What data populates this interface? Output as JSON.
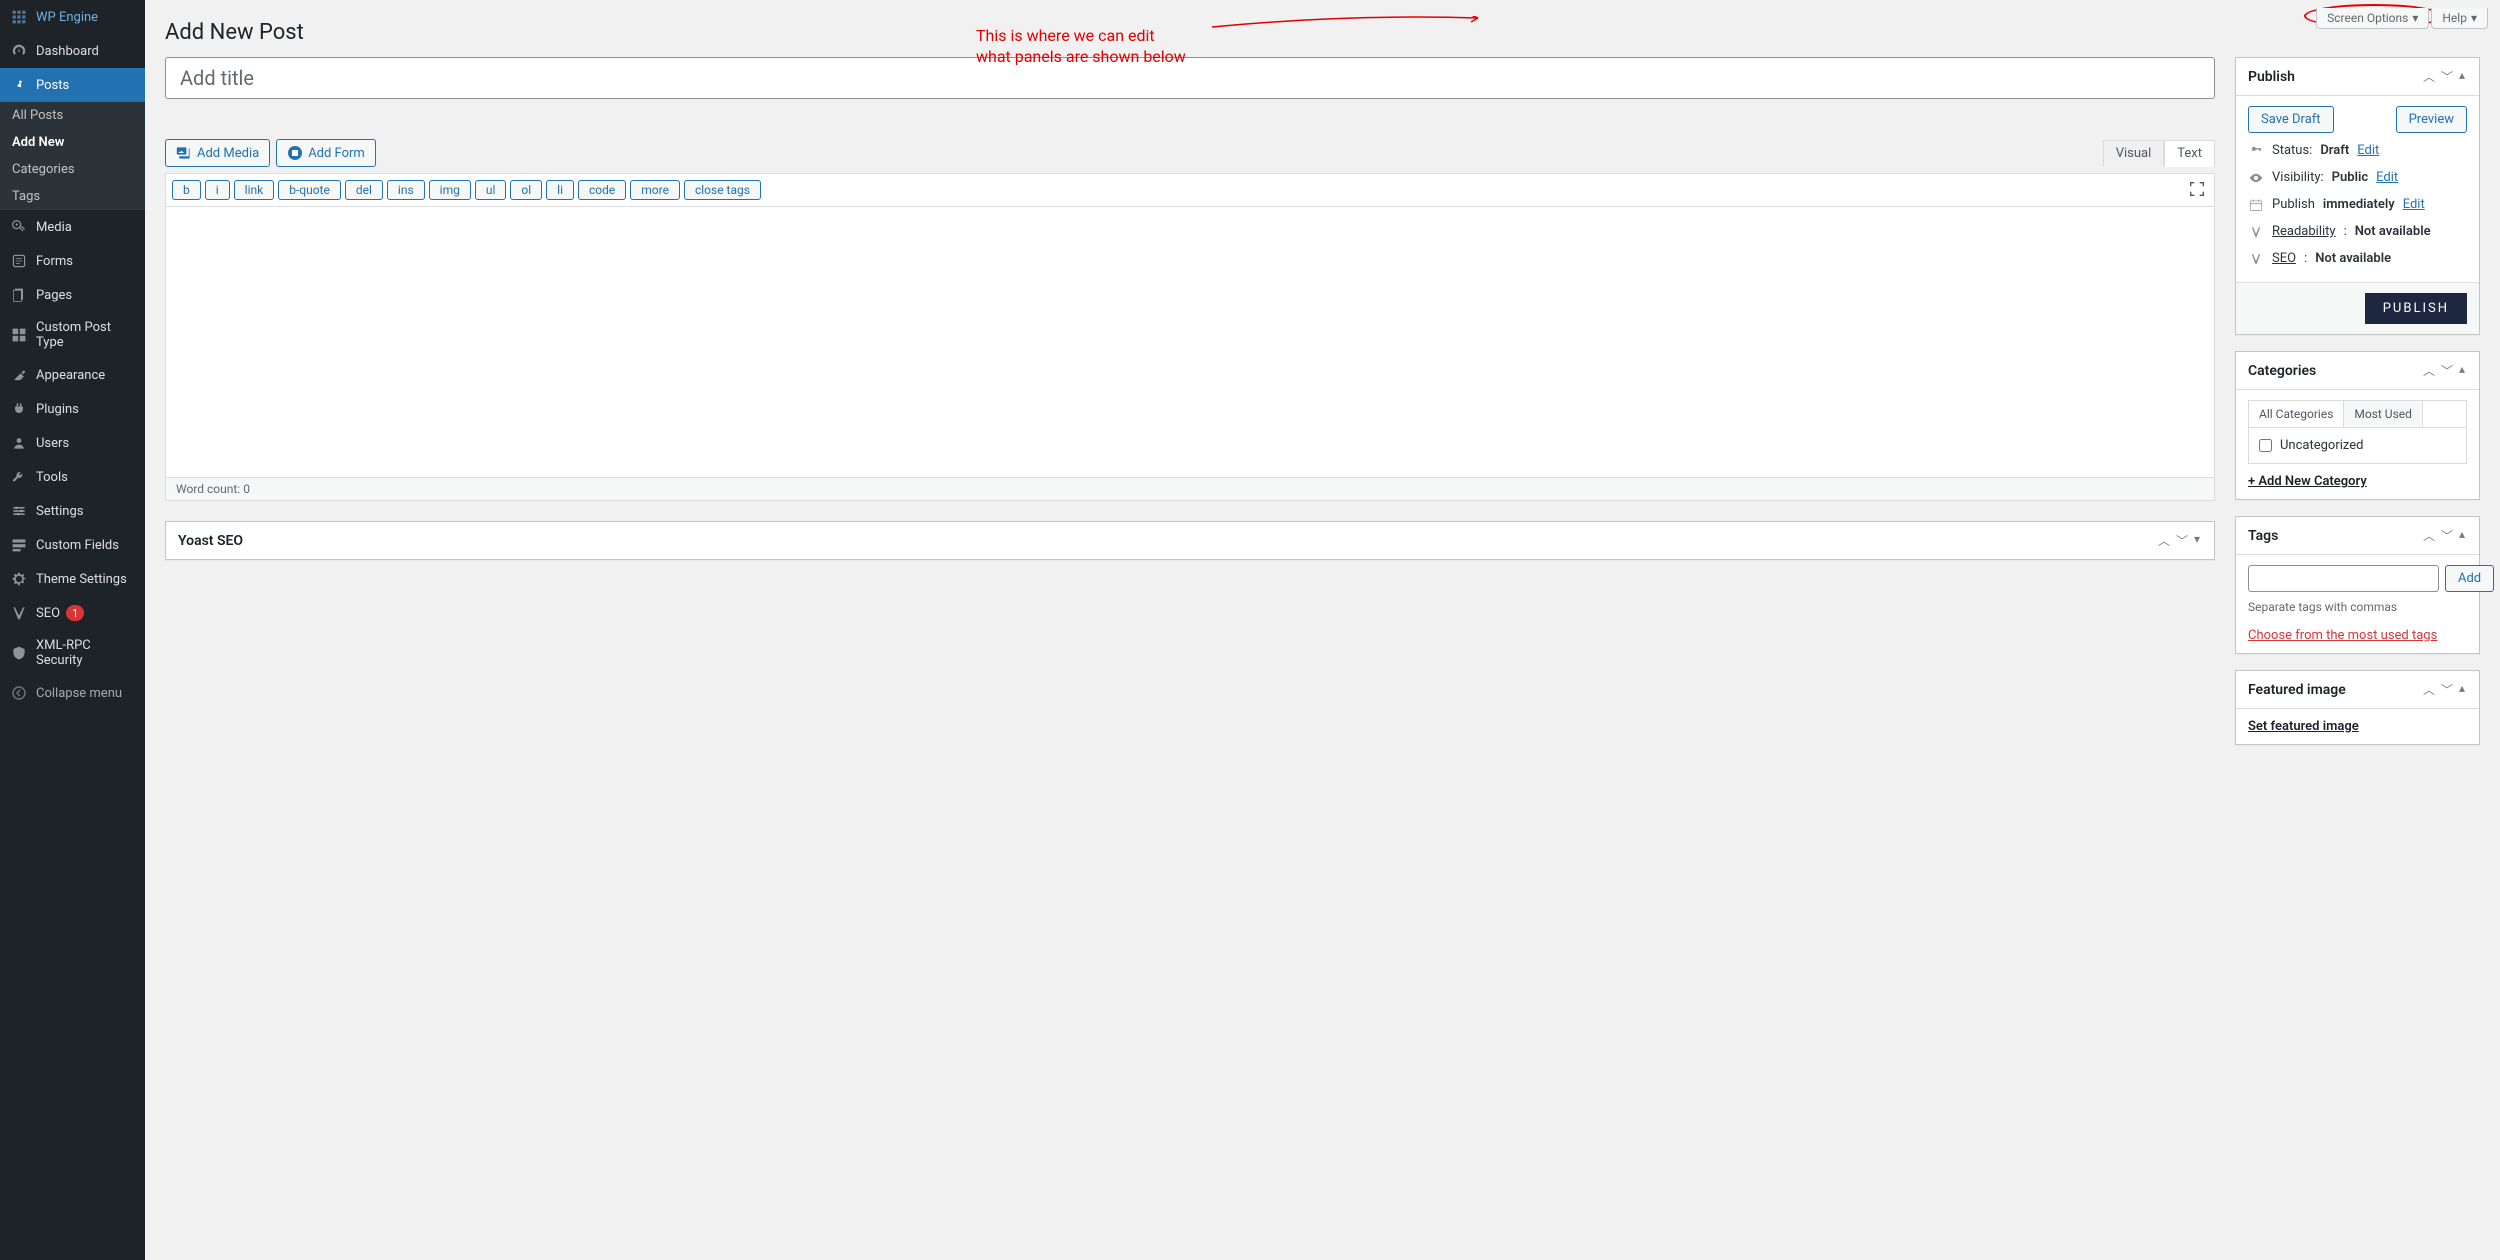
{
  "annotation": {
    "line1": "This is where we can edit",
    "line2": "what panels are shown below"
  },
  "topbar": {
    "screen_options": "Screen Options",
    "help": "Help"
  },
  "sidebar": {
    "items": [
      {
        "label": "WP Engine",
        "icon": "wpengine"
      },
      {
        "label": "Dashboard",
        "icon": "dashboard"
      },
      {
        "label": "Posts",
        "icon": "pin",
        "active": true,
        "sub": [
          {
            "label": "All Posts"
          },
          {
            "label": "Add New",
            "sub_active": true
          },
          {
            "label": "Categories"
          },
          {
            "label": "Tags"
          }
        ]
      },
      {
        "label": "Media",
        "icon": "media"
      },
      {
        "label": "Forms",
        "icon": "forms"
      },
      {
        "label": "Pages",
        "icon": "pages"
      },
      {
        "label": "Custom Post Type",
        "icon": "cpt"
      },
      {
        "label": "Appearance",
        "icon": "appearance"
      },
      {
        "label": "Plugins",
        "icon": "plugins"
      },
      {
        "label": "Users",
        "icon": "users"
      },
      {
        "label": "Tools",
        "icon": "tools"
      },
      {
        "label": "Settings",
        "icon": "settings"
      },
      {
        "label": "Custom Fields",
        "icon": "fields"
      },
      {
        "label": "Theme Settings",
        "icon": "gear"
      },
      {
        "label": "SEO",
        "icon": "yoast",
        "badge": "1"
      },
      {
        "label": "XML-RPC Security",
        "icon": "shield"
      }
    ],
    "collapse": "Collapse menu"
  },
  "page": {
    "heading": "Add New Post",
    "title_placeholder": "Add title"
  },
  "editor": {
    "add_media": "Add Media",
    "add_form": "Add Form",
    "tab_visual": "Visual",
    "tab_text": "Text",
    "quicktags": [
      "b",
      "i",
      "link",
      "b-quote",
      "del",
      "ins",
      "img",
      "ul",
      "ol",
      "li",
      "code",
      "more",
      "close tags"
    ],
    "word_count_label": "Word count:",
    "word_count": "0"
  },
  "yoast_box": {
    "title": "Yoast SEO"
  },
  "publish": {
    "title": "Publish",
    "save_draft": "Save Draft",
    "preview": "Preview",
    "status_label": "Status:",
    "status_value": "Draft",
    "visibility_label": "Visibility:",
    "visibility_value": "Public",
    "schedule_label": "Publish",
    "schedule_value": "immediately",
    "readability_label": "Readability",
    "readability_value": "Not available",
    "seo_label": "SEO",
    "seo_value": "Not available",
    "edit": "Edit",
    "publish_btn": "PUBLISH"
  },
  "categories": {
    "title": "Categories",
    "tab_all": "All Categories",
    "tab_most": "Most Used",
    "options": [
      "Uncategorized"
    ],
    "add_new": "+ Add New Category"
  },
  "tags": {
    "title": "Tags",
    "add": "Add",
    "hint": "Separate tags with commas",
    "choose": "Choose from the most used tags"
  },
  "featured": {
    "title": "Featured image",
    "set": "Set featured image"
  }
}
